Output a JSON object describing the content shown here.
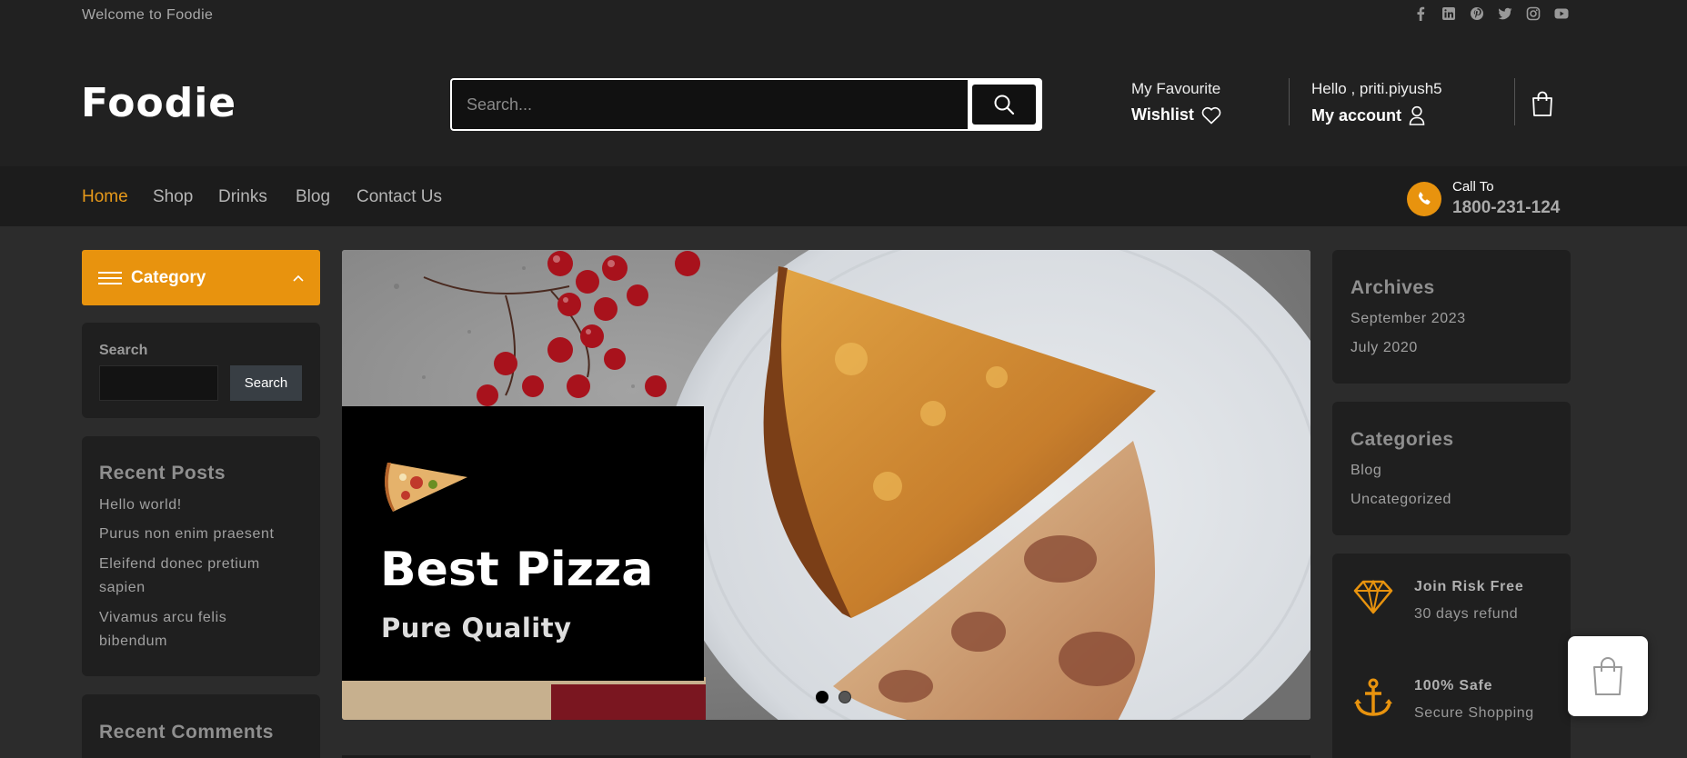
{
  "topbar": {
    "welcome": "Welcome to Foodie",
    "social_icons": [
      "facebook-icon",
      "linkedin-icon",
      "pinterest-icon",
      "twitter-icon",
      "instagram-icon",
      "youtube-icon"
    ]
  },
  "header": {
    "logo": "Foodie",
    "search_placeholder": "Search...",
    "favourite_small": "My Favourite",
    "favourite_big": "Wishlist",
    "account_small": "Hello , priti.piyush5",
    "account_big": "My account"
  },
  "nav": {
    "items": [
      "Home",
      "Shop",
      "Drinks",
      "Blog",
      "Contact Us"
    ],
    "active": "Home",
    "call_label": "Call To",
    "call_number": "1800-231-124"
  },
  "left_sidebar": {
    "category_title": "Category",
    "search_label": "Search",
    "search_button": "Search",
    "recent_posts_title": "Recent Posts",
    "recent_posts": [
      "Hello world!",
      "Purus non enim praesent",
      "Eleifend donec pretium sapien",
      "Vivamus arcu felis bibendum"
    ],
    "recent_comments_title": "Recent Comments"
  },
  "slider": {
    "heading": "Best Pizza",
    "subheading": "Pure Quality",
    "dots": 2,
    "active_dot": 0
  },
  "right_sidebar": {
    "archives_title": "Archives",
    "archives": [
      "September 2023",
      "July 2020"
    ],
    "categories_title": "Categories",
    "categories": [
      "Blog",
      "Uncategorized"
    ],
    "features": [
      {
        "title": "Join Risk Free",
        "subtitle": "30 days refund"
      },
      {
        "title": "100% Safe",
        "subtitle": "Secure Shopping"
      }
    ]
  },
  "colors": {
    "accent": "#e8930e",
    "background": "#2c2c2c",
    "header": "#212121",
    "panel": "#1f1f1f"
  }
}
